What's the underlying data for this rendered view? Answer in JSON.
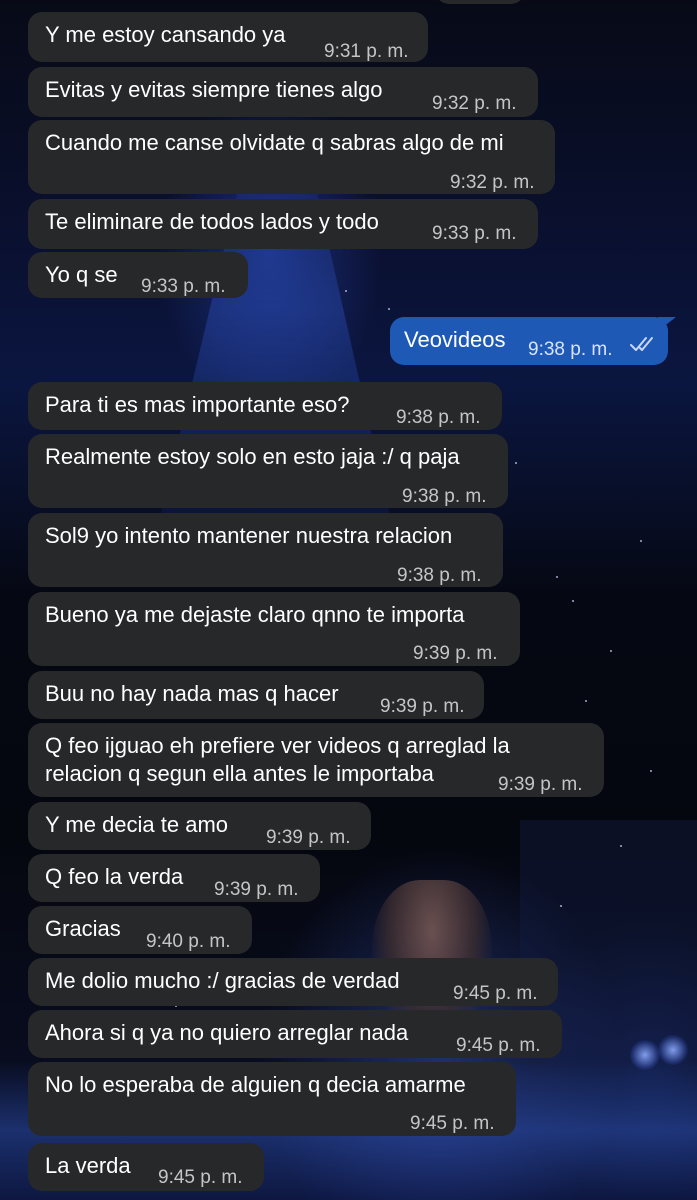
{
  "conversation": {
    "messages": [
      {
        "dir": "in",
        "text": "Y me estoy cansando ya",
        "time": "9:31 p. m."
      },
      {
        "dir": "in",
        "text": "Evitas y evitas siempre tienes algo",
        "time": "9:32 p. m."
      },
      {
        "dir": "in",
        "text": "Cuando me canse olvidate q sabras algo de mi",
        "time": "9:32 p. m."
      },
      {
        "dir": "in",
        "text": "Te eliminare de todos lados y todo",
        "time": "9:33 p. m."
      },
      {
        "dir": "in",
        "text": "Yo q se",
        "time": "9:33 p. m."
      },
      {
        "dir": "out",
        "text": "Veovideos",
        "time": "9:38 p. m.",
        "status": "read"
      },
      {
        "dir": "in",
        "text": "Para ti es mas importante eso?",
        "time": "9:38 p. m."
      },
      {
        "dir": "in",
        "text": "Realmente estoy solo en esto jaja :/ q paja",
        "time": "9:38 p. m."
      },
      {
        "dir": "in",
        "text": "Sol9 yo intento mantener nuestra relacion",
        "time": "9:38 p. m."
      },
      {
        "dir": "in",
        "text": "Bueno ya me dejaste claro qnno te importa",
        "time": "9:39 p. m."
      },
      {
        "dir": "in",
        "text": "Buu no hay nada mas q hacer",
        "time": "9:39 p. m."
      },
      {
        "dir": "in",
        "text": "Q feo ijguao eh prefiere ver videos q arreglad la",
        "text2": "relacion q segun ella antes le importaba",
        "time": "9:39 p. m."
      },
      {
        "dir": "in",
        "text": "Y me decia te amo",
        "time": "9:39 p. m."
      },
      {
        "dir": "in",
        "text": "Q feo la verda",
        "time": "9:39 p. m."
      },
      {
        "dir": "in",
        "text": "Gracias",
        "time": "9:40 p. m."
      },
      {
        "dir": "in",
        "text": "Me dolio mucho :/ gracias de verdad",
        "time": "9:45 p. m."
      },
      {
        "dir": "in",
        "text": "Ahora si q ya no quiero arreglar nada",
        "time": "9:45 p. m."
      },
      {
        "dir": "in",
        "text": "No lo esperaba de alguien q decia amarme",
        "time": "9:45 p. m."
      },
      {
        "dir": "in",
        "text": "La verda",
        "time": "9:45 p. m."
      }
    ]
  },
  "theme": {
    "incoming_bubble": "#272829",
    "outgoing_bubble": "#1f59b6",
    "text": "#ffffff",
    "timestamp": "#c5c5c5",
    "read_ticks": "#c9d7ff"
  },
  "icons": {
    "read_receipt": "double-check-icon"
  }
}
